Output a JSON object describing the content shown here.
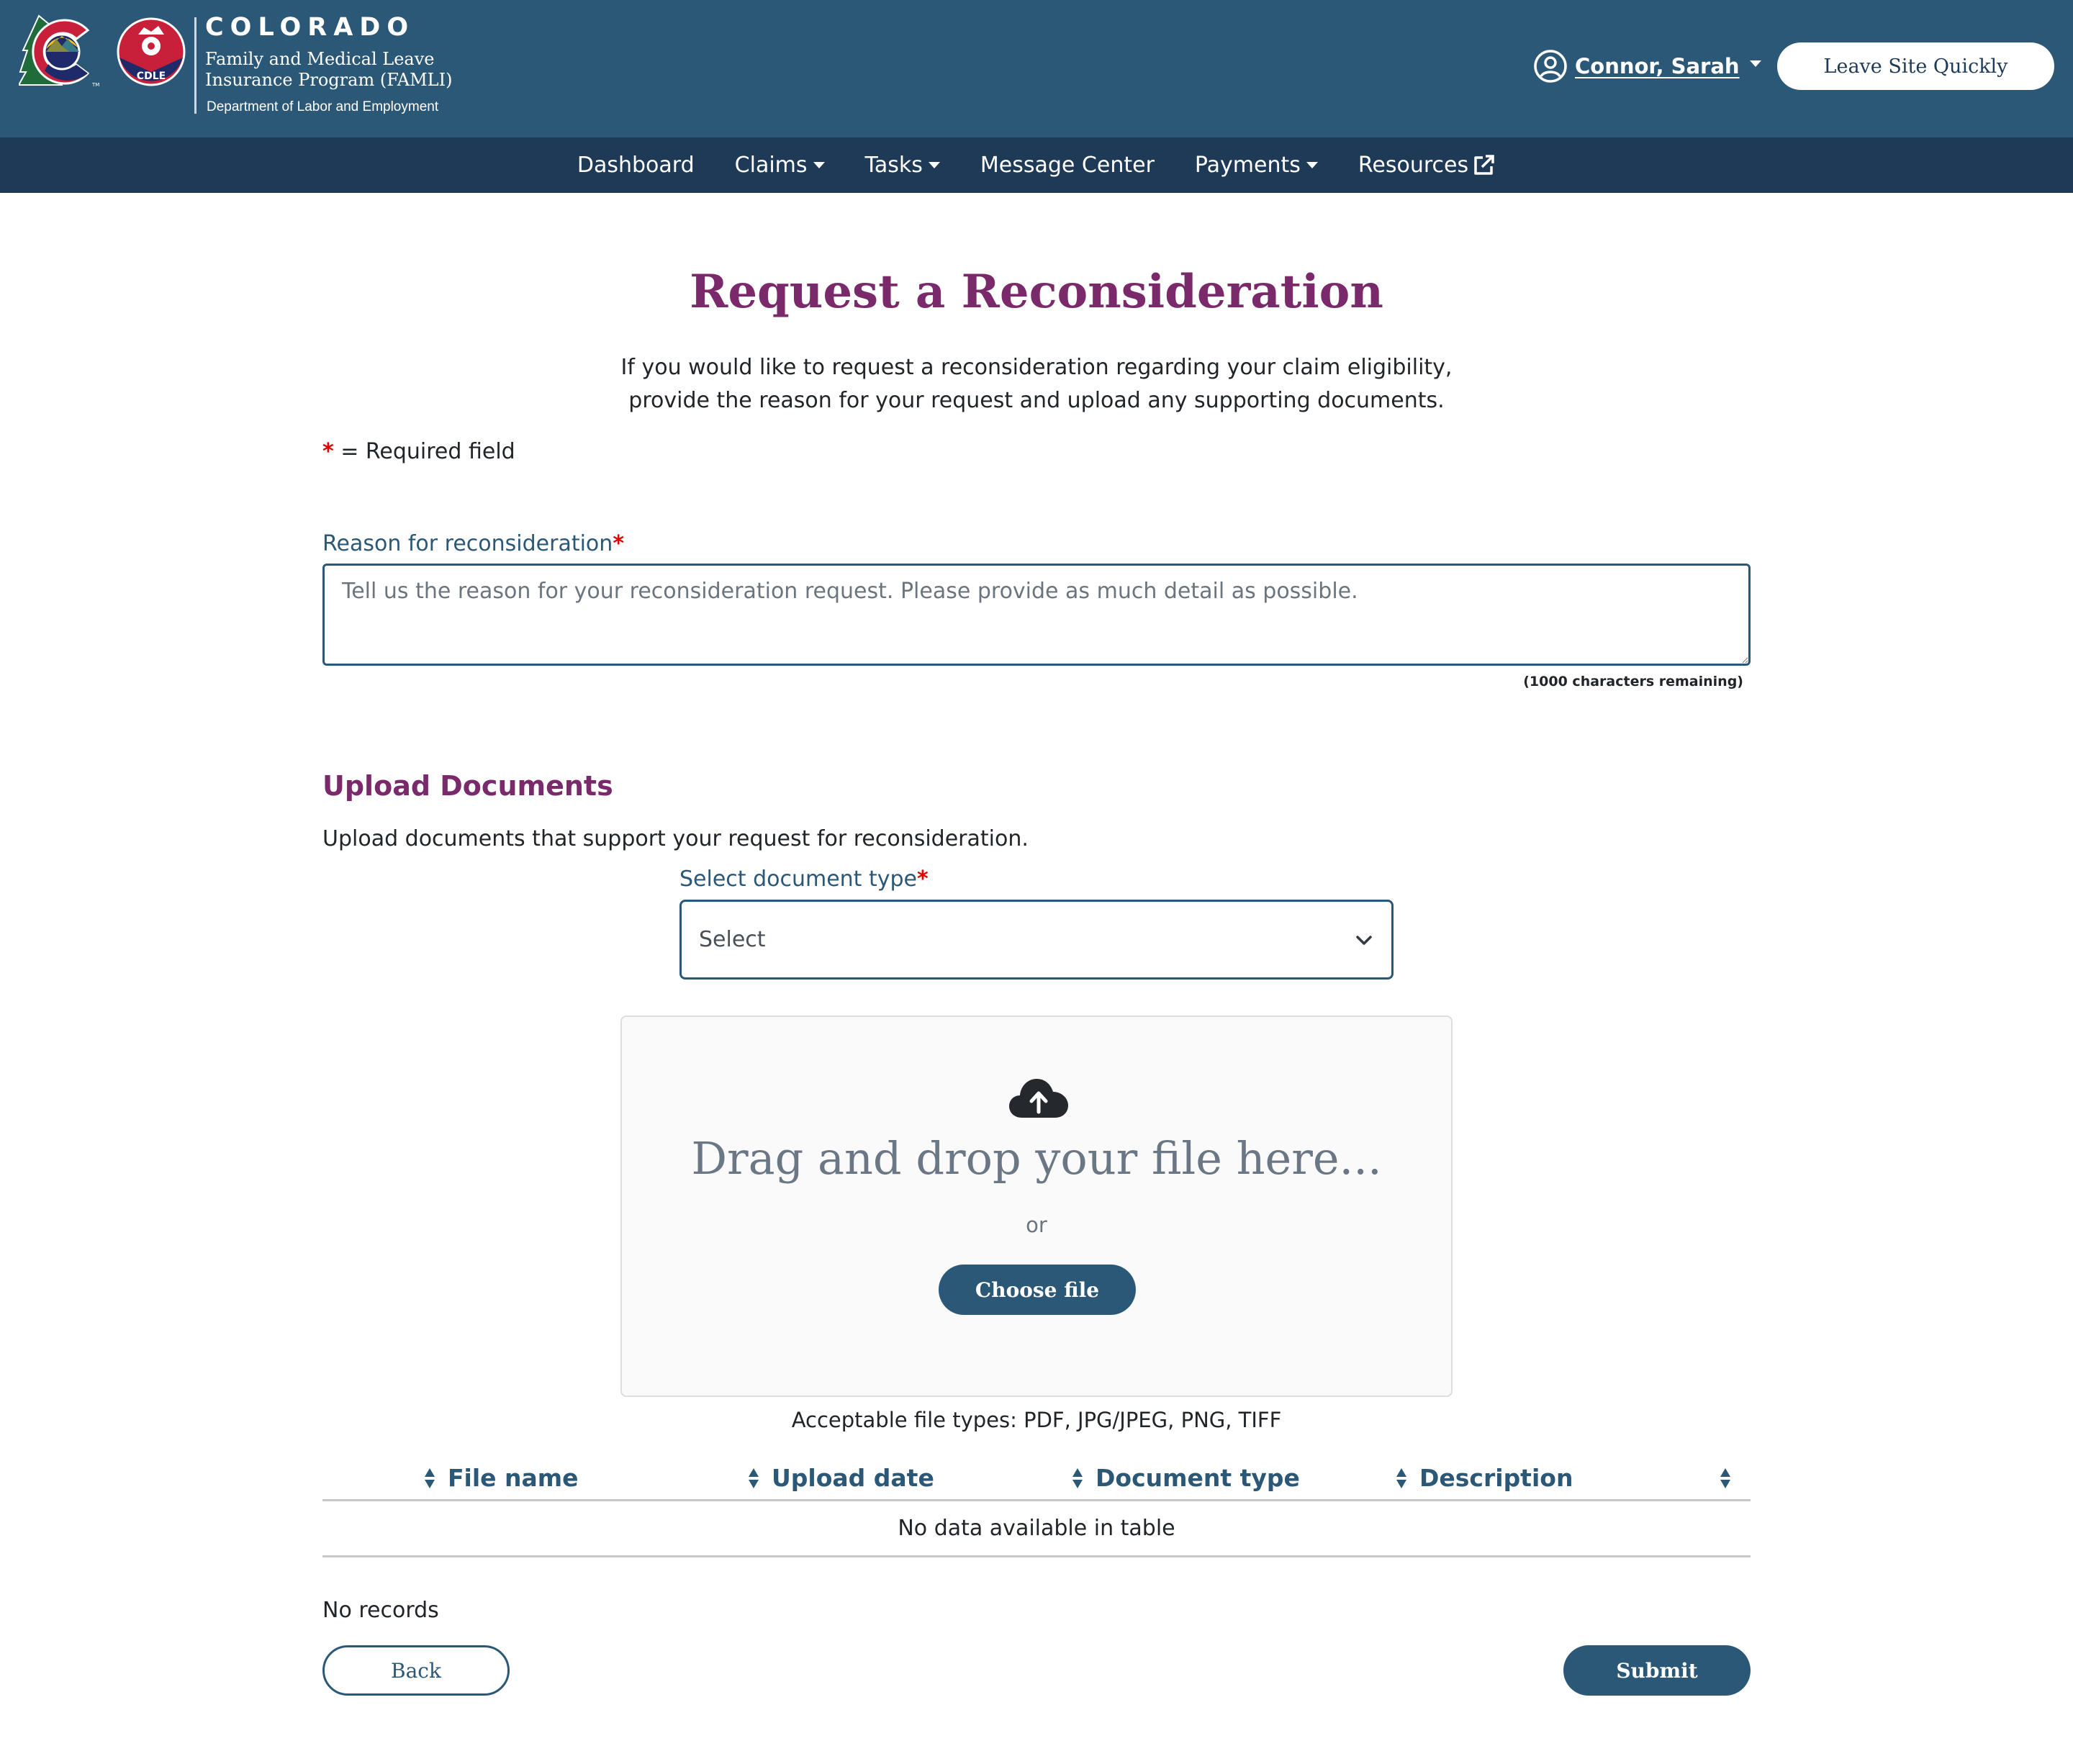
{
  "colors": {
    "header_bg": "#2c5878",
    "nav_bg": "#1e3a56",
    "accent_purple": "#7a2a6a",
    "primary_blue": "#2c5878",
    "required_red": "#e00000"
  },
  "header": {
    "logo_alt": "Colorado CDLE logo",
    "logo_badge_text": "CDLE",
    "state": "COLORADO",
    "program": "Family and Medical Leave Insurance Program (FAMLI)",
    "department": "Department of Labor and Employment",
    "user": {
      "icon": "user-circle-icon",
      "name": "Connor, Sarah"
    },
    "leave_site_label": "Leave Site Quickly"
  },
  "nav": {
    "items": [
      {
        "label": "Dashboard",
        "dropdown": false
      },
      {
        "label": "Claims",
        "dropdown": true
      },
      {
        "label": "Tasks",
        "dropdown": true
      },
      {
        "label": "Message Center",
        "dropdown": false
      },
      {
        "label": "Payments",
        "dropdown": true
      },
      {
        "label": "Resources",
        "dropdown": false,
        "icon": "external-link-icon"
      }
    ]
  },
  "page": {
    "title": "Request a Reconsideration",
    "intro_line1": "If you would like to request a reconsideration regarding your claim eligibility,",
    "intro_line2": "provide the reason for your request and upload any supporting documents.",
    "required_star": "*",
    "required_note": " = Required field"
  },
  "reason": {
    "label": "Reason for reconsideration",
    "required": "*",
    "value": "",
    "placeholder": "Tell us the reason for your reconsideration request. Please provide as much detail as possible.",
    "char_count": "(1000 characters remaining)"
  },
  "upload": {
    "title": "Upload Documents",
    "description": "Upload documents that support your request for reconsideration.",
    "doc_type_label": "Select document type",
    "doc_type_required": "*",
    "doc_type_selected": "Select",
    "dropzone": {
      "icon": "cloud-upload-icon",
      "text": "Drag and drop your file here...",
      "or": "or",
      "choose_label": "Choose file"
    },
    "file_types": "Acceptable file types: PDF, JPG/JPEG, PNG, TIFF"
  },
  "table": {
    "columns": [
      "",
      "File name",
      "Upload date",
      "Document type",
      "Description"
    ],
    "empty_message": "No data available in table",
    "records_text": "No records"
  },
  "actions": {
    "back_label": "Back",
    "submit_label": "Submit"
  }
}
